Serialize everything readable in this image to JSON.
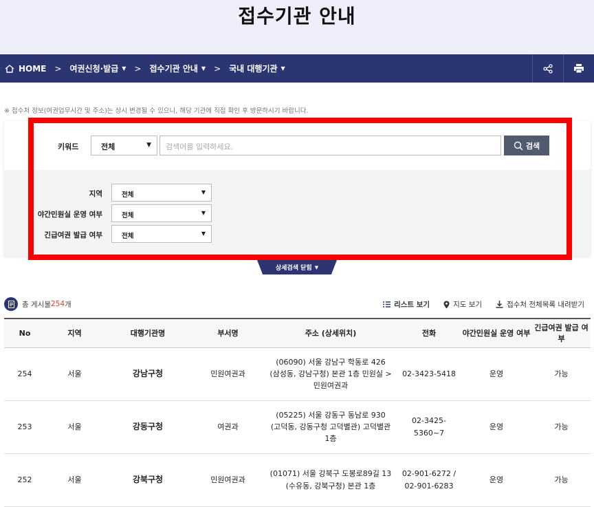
{
  "page": {
    "title": "접수기관 안내"
  },
  "nav": {
    "home": "HOME",
    "crumbs": [
      {
        "label": "여권신청·발급"
      },
      {
        "label": "접수기관 안내"
      },
      {
        "label": "국내 대행기관"
      }
    ],
    "separator": ">"
  },
  "notice": "※ 접수처 정보(여권업무시간 및 주소)는 상시 변경될 수 있으니, 해당 기관에 직접 확인 후 방문하시기 바랍니다.",
  "search": {
    "keyword_label": "키워드",
    "keyword_select": "전체",
    "placeholder": "검색어를 입력하세요.",
    "button": "검색",
    "filters": [
      {
        "label": "지역",
        "value": "전체"
      },
      {
        "label": "야간민원실 운영 여부",
        "value": "전체"
      },
      {
        "label": "긴급여권 발급 여부",
        "value": "전체"
      }
    ],
    "toggle_label": "상세검색 닫힘"
  },
  "summary": {
    "prefix": "총 게시물 ",
    "count": "254",
    "suffix": "개"
  },
  "views": {
    "list": "리스트 보기",
    "map": "지도 보기",
    "download": "접수처 전체목록 내려받기"
  },
  "table": {
    "headers": [
      "No",
      "지역",
      "대행기관명",
      "부서명",
      "주소 (상세위치)",
      "전화",
      "야간민원실 운영 여부",
      "긴급여권 발급 여부"
    ],
    "rows": [
      {
        "no": "254",
        "region": "서울",
        "name": "강남구청",
        "dept": "민원여권과",
        "addr1": "(06090) 서울 강남구 학동로 426",
        "addr2": "(삼성동, 강남구청) 본관 1층 민원실 >",
        "addr3": "민원여권과",
        "tel1": "02-3423-5418",
        "tel2": "",
        "night": "운영",
        "urgent": "가능"
      },
      {
        "no": "253",
        "region": "서울",
        "name": "강동구청",
        "dept": "여권과",
        "addr1": "(05225) 서울 강동구 동남로 930",
        "addr2": "(고덕동, 강동구청 고덕별관) 고덕별관",
        "addr3": "1층",
        "tel1": "02-3425-",
        "tel2": "5360~7",
        "night": "운영",
        "urgent": "가능"
      },
      {
        "no": "252",
        "region": "서울",
        "name": "강북구청",
        "dept": "민원여권과",
        "addr1": "(01071) 서울 강북구 도봉로89길 13",
        "addr2": "(수유동, 강북구청) 본관 1층",
        "addr3": "",
        "tel1": "02-901-6272 /",
        "tel2": "02-901-6283",
        "night": "운영",
        "urgent": "가능"
      }
    ]
  },
  "colors": {
    "navy": "#2b3572",
    "accent_red": "#e23b2e",
    "highlight": "#ff0000"
  }
}
